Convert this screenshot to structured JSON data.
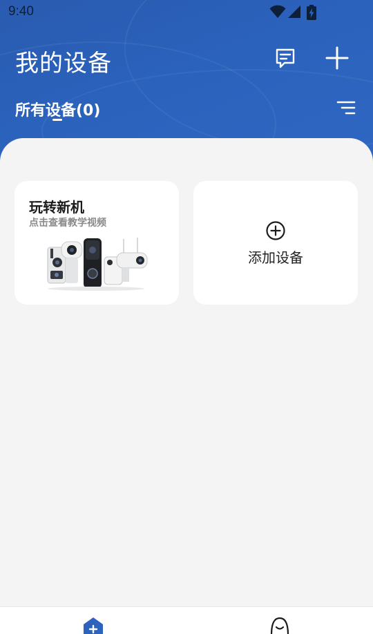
{
  "status_bar": {
    "time": "9:40",
    "icons": [
      "wifi-icon",
      "cell-signal-icon",
      "battery-charging-icon"
    ]
  },
  "header": {
    "title": "我的设备",
    "actions": [
      "message-icon",
      "plus-icon"
    ],
    "tab_label": "所有设备(0)",
    "sort_icon": "sort-lines-icon"
  },
  "cards": {
    "promo": {
      "title": "玩转新机",
      "subtitle": "点击查看教学视频",
      "image": "security-cameras-product-photo"
    },
    "add_device": {
      "icon": "circle-plus-icon",
      "label": "添加设备"
    }
  },
  "bottom_nav": {
    "items": [
      "home-add-icon",
      "profile-face-icon"
    ]
  },
  "colors": {
    "header_blue": "#2b62bc",
    "background": "#f4f4f5",
    "card": "#ffffff"
  }
}
